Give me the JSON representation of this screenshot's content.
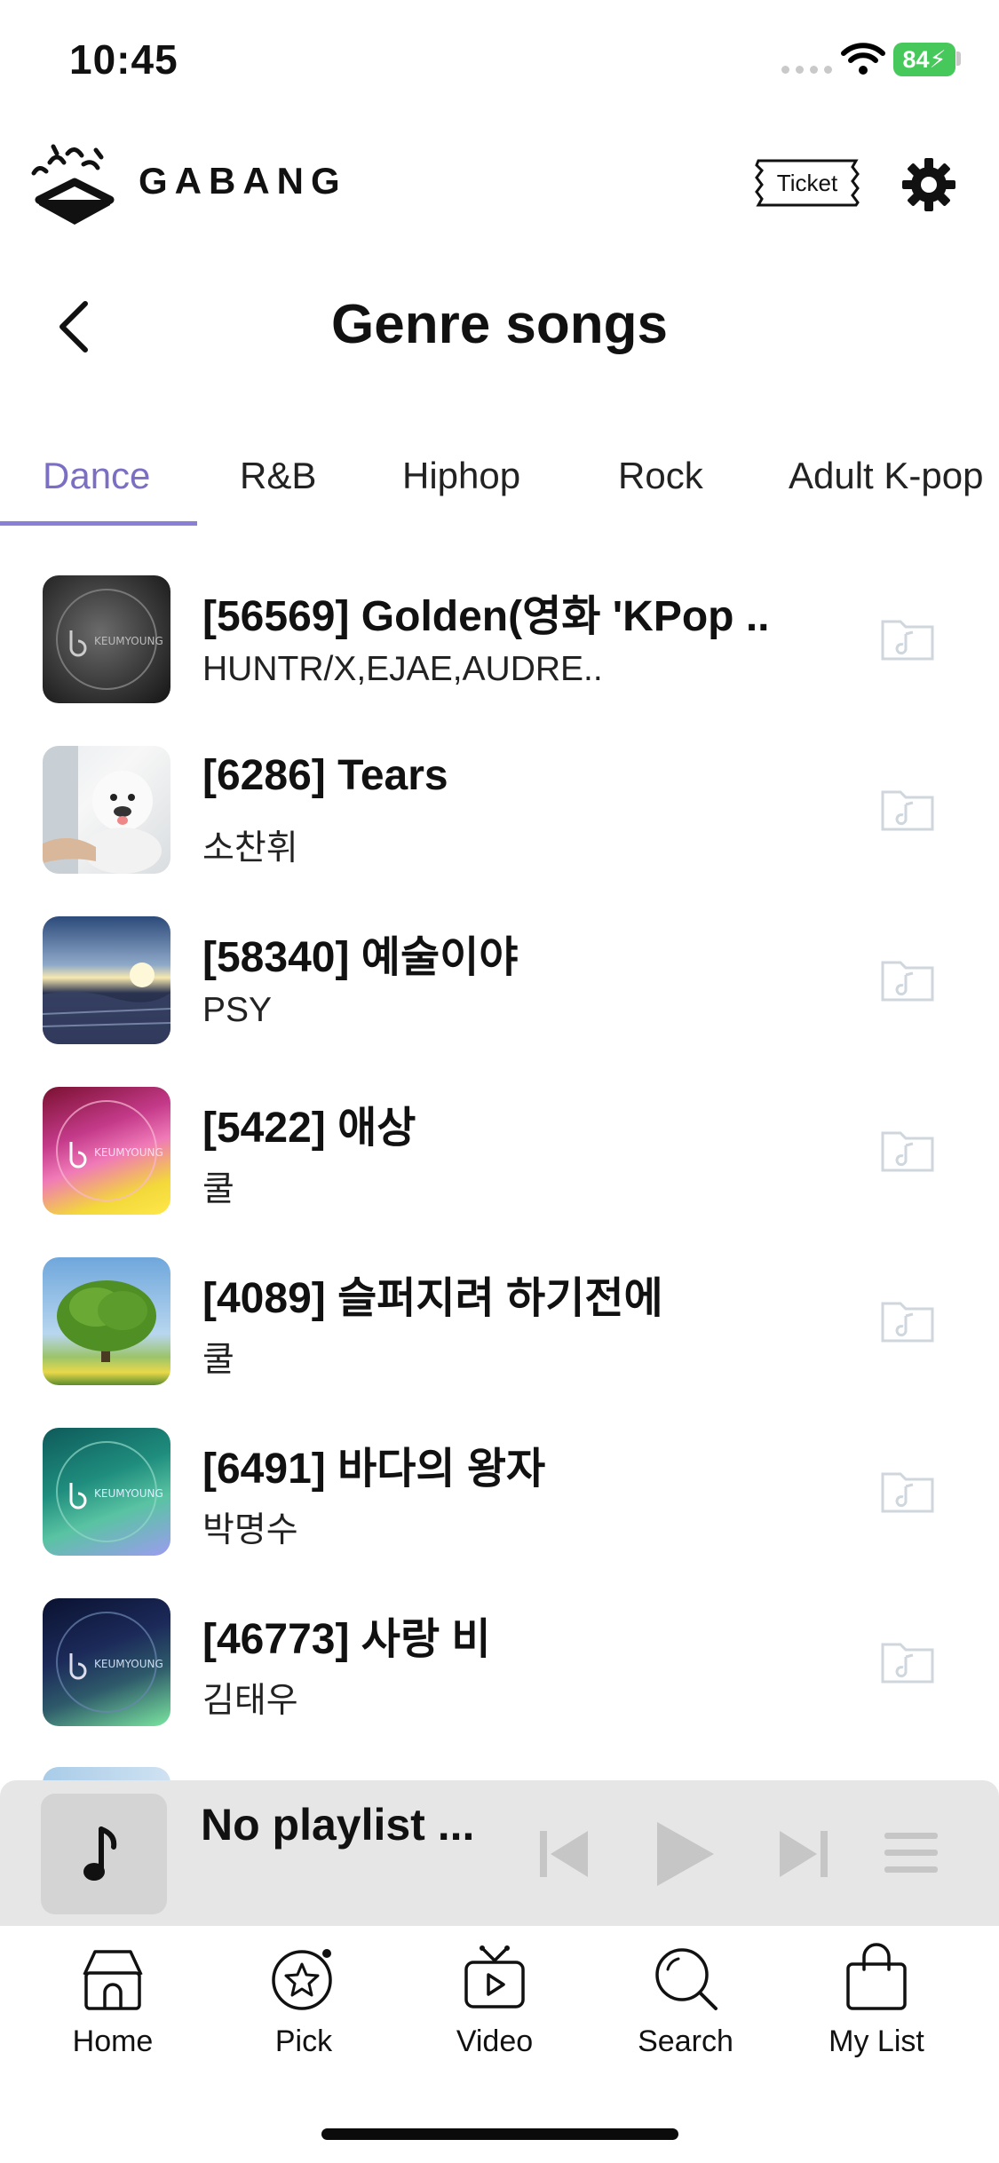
{
  "status_bar": {
    "time": "10:45",
    "battery": "84"
  },
  "header": {
    "brand": "GABANG",
    "ticket_label": "Ticket"
  },
  "page": {
    "title": "Genre songs"
  },
  "tabs": [
    {
      "label": "Dance",
      "active": true
    },
    {
      "label": "R&B",
      "active": false
    },
    {
      "label": "Hiphop",
      "active": false
    },
    {
      "label": "Rock",
      "active": false
    },
    {
      "label": "Adult K-pop",
      "active": false
    }
  ],
  "songs": [
    {
      "title": "[56569] Golden(영화 'KPop ...",
      "artist": "HUNTR/X,EJAE,AUDRE..",
      "thumb": "keumyoung-gray"
    },
    {
      "title": "[6286] Tears",
      "artist": "소찬휘",
      "thumb": "white-puppy"
    },
    {
      "title": "[58340] 예술이야",
      "artist": "PSY",
      "thumb": "winter-sunset"
    },
    {
      "title": "[5422] 애상",
      "artist": "쿨",
      "thumb": "keumyoung-magenta"
    },
    {
      "title": "[4089] 슬퍼지려 하기전에",
      "artist": "쿨",
      "thumb": "green-tree"
    },
    {
      "title": "[6491] 바다의 왕자",
      "artist": "박명수",
      "thumb": "keumyoung-teal"
    },
    {
      "title": "[46773] 사랑 비",
      "artist": "김태우",
      "thumb": "keumyoung-navy"
    }
  ],
  "player": {
    "title": "No playlist ..."
  },
  "bottom_nav": [
    {
      "label": "Home",
      "icon": "home-icon"
    },
    {
      "label": "Pick",
      "icon": "star-icon"
    },
    {
      "label": "Video",
      "icon": "tv-play-icon"
    },
    {
      "label": "Search",
      "icon": "search-icon"
    },
    {
      "label": "My List",
      "icon": "bag-icon"
    }
  ],
  "colors": {
    "accent": "#7b6fc4",
    "player_bg": "#e6e6e6",
    "battery": "#46c85a"
  }
}
